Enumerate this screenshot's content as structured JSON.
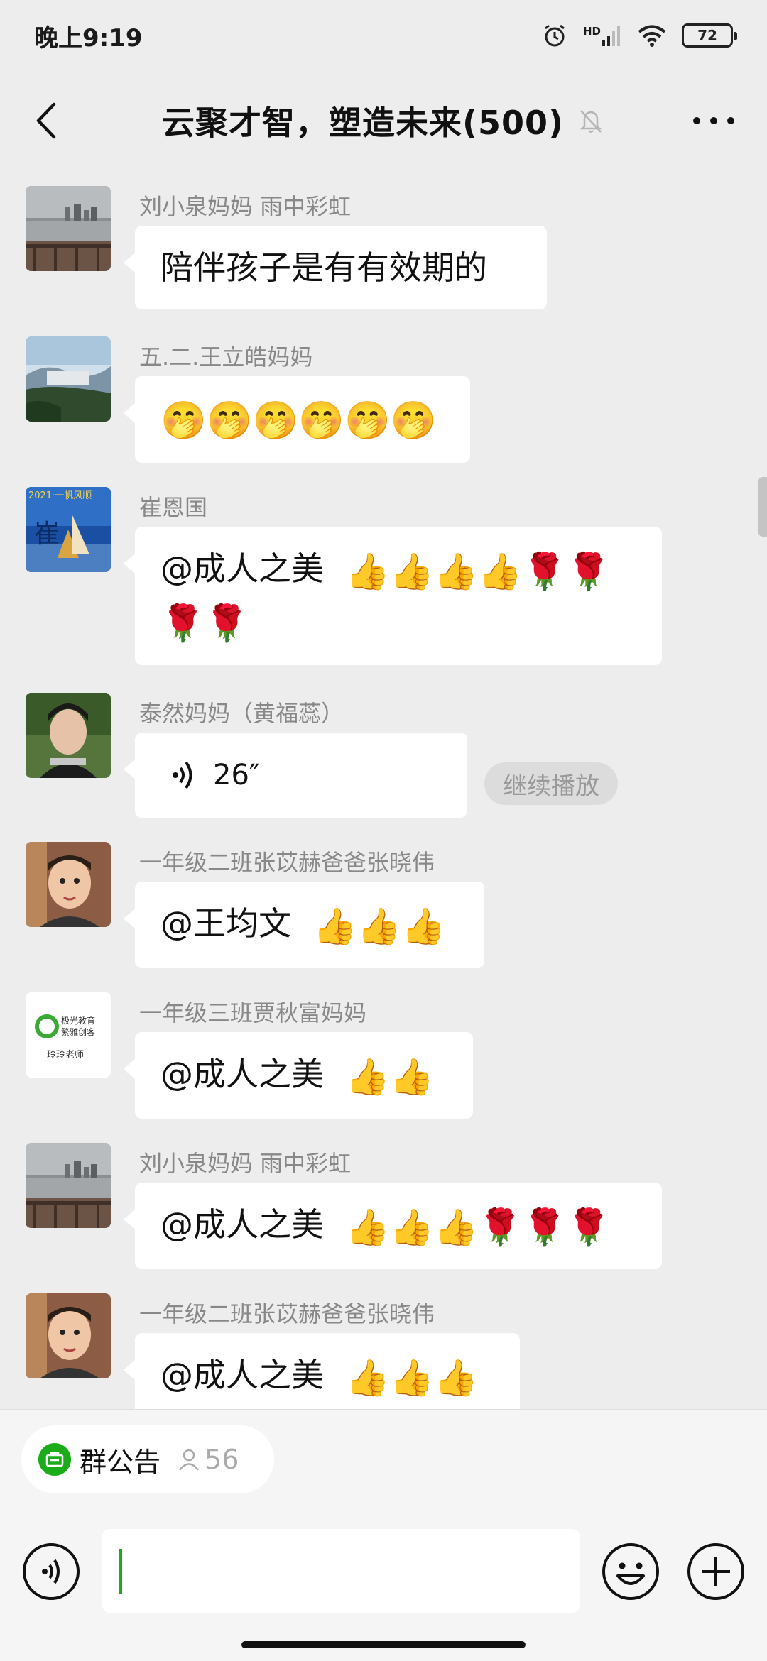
{
  "status_bar": {
    "time": "晚上9:19",
    "battery": "72",
    "network": "HD"
  },
  "header": {
    "title": "云聚才智，塑造未来(500)",
    "back_icon": "chevron-left-icon",
    "more_icon": "more-dots-icon",
    "muted_icon": "bell-off-icon"
  },
  "messages": [
    {
      "sender": "刘小泉妈妈  雨中彩虹",
      "text": "陪伴孩子是有有效期的",
      "emoji": ""
    },
    {
      "sender": "五.二.王立皓妈妈",
      "text": "",
      "emoji": "🤭🤭🤭🤭🤭🤭"
    },
    {
      "sender": "崔恩国",
      "text": "@成人之美",
      "emoji": "👍👍👍👍🌹🌹",
      "emoji_line2": "🌹🌹"
    },
    {
      "sender": "泰然妈妈（黄福蕊）",
      "voice_duration": "26″",
      "voice_action": "继续播放"
    },
    {
      "sender": "一年级二班张苡赫爸爸张晓伟",
      "text": "@王均文",
      "emoji": "👍👍👍"
    },
    {
      "sender": "一年级三班贾秋富妈妈",
      "text": "@成人之美",
      "emoji": "👍👍",
      "avatar_text_1": "极光教育",
      "avatar_text_2": "繁雅创客",
      "avatar_text_3": "玲玲老师"
    },
    {
      "sender": "刘小泉妈妈  雨中彩虹",
      "text": "@成人之美",
      "emoji": "👍👍👍🌹🌹🌹"
    },
    {
      "sender": "一年级二班张苡赫爸爸张晓伟",
      "text": "@成人之美",
      "emoji": "👍👍👍"
    }
  ],
  "avatar_misc": {
    "calligraphy_year": "2021·一帆风顺",
    "calligraphy_char": "崔"
  },
  "bottom_bar": {
    "notice_label": "群公告",
    "notice_count": "56"
  },
  "colors": {
    "background": "#ededed",
    "bubble": "#ffffff",
    "accent_green": "#1aad19",
    "sender_text": "#888888"
  }
}
